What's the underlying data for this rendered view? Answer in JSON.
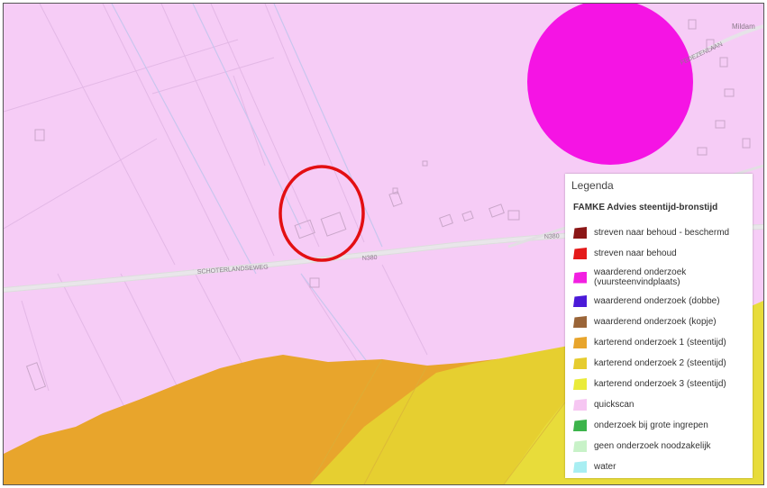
{
  "map": {
    "road_labels": {
      "schoterlandseweg": "SCHOTERLANDSEWEG",
      "n380_center": "N380",
      "n380_right": "N380",
      "fedezenlaan": "FEDEZENLAAN",
      "mildam": "Mildam"
    },
    "colors": {
      "quickscan_bg": "#f6ccf6",
      "orange_zone": "#e8a52c",
      "yellow_zone": "#e6d12f",
      "yellow_light_zone": "#e9e040",
      "magenta_circle": "#f514e4",
      "marker_circle": "#e30f12"
    }
  },
  "legend": {
    "title": "Legenda",
    "layer_title": "FAMKE Advies steentijd-bronstijd",
    "items": [
      {
        "label": "streven naar behoud - beschermd",
        "color": "#8b1616"
      },
      {
        "label": "streven naar behoud",
        "color": "#e41a1a"
      },
      {
        "label": "waarderend onderzoek (vuursteenvindplaats)",
        "color": "#f21fe1"
      },
      {
        "label": "waarderend onderzoek (dobbe)",
        "color": "#4b1ad8"
      },
      {
        "label": "waarderend onderzoek (kopje)",
        "color": "#9a6538"
      },
      {
        "label": "karterend onderzoek 1 (steentijd)",
        "color": "#e8a52c"
      },
      {
        "label": "karterend onderzoek 2 (steentijd)",
        "color": "#e6cc2e"
      },
      {
        "label": "karterend onderzoek 3 (steentijd)",
        "color": "#eaeb3a"
      },
      {
        "label": "quickscan",
        "color": "#f6c6f2"
      },
      {
        "label": "onderzoek bij grote ingrepen",
        "color": "#3cb44b"
      },
      {
        "label": "geen onderzoek noodzakelijk",
        "color": "#c8f2c8"
      },
      {
        "label": "water",
        "color": "#a8eef2"
      }
    ]
  }
}
